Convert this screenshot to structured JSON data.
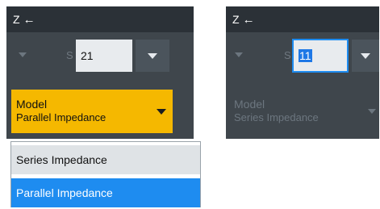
{
  "left_panel": {
    "header_label": "Z",
    "header_arrow": "←",
    "s_label": "S",
    "value": "21",
    "model_title": "Model",
    "model_value": "Parallel Impedance",
    "dropdown_options": [
      "Series Impedance",
      "Parallel Impedance"
    ],
    "selected_option": "Parallel Impedance"
  },
  "right_panel": {
    "header_label": "Z",
    "header_arrow": "←",
    "s_label": "S",
    "value": "11",
    "model_title": "Model",
    "model_value": "Series Impedance"
  },
  "colors": {
    "panel_bg": "#3f464c",
    "header_bg": "#2b3137",
    "accent_yellow": "#f5b800",
    "focus_blue": "#1e8cf0"
  }
}
